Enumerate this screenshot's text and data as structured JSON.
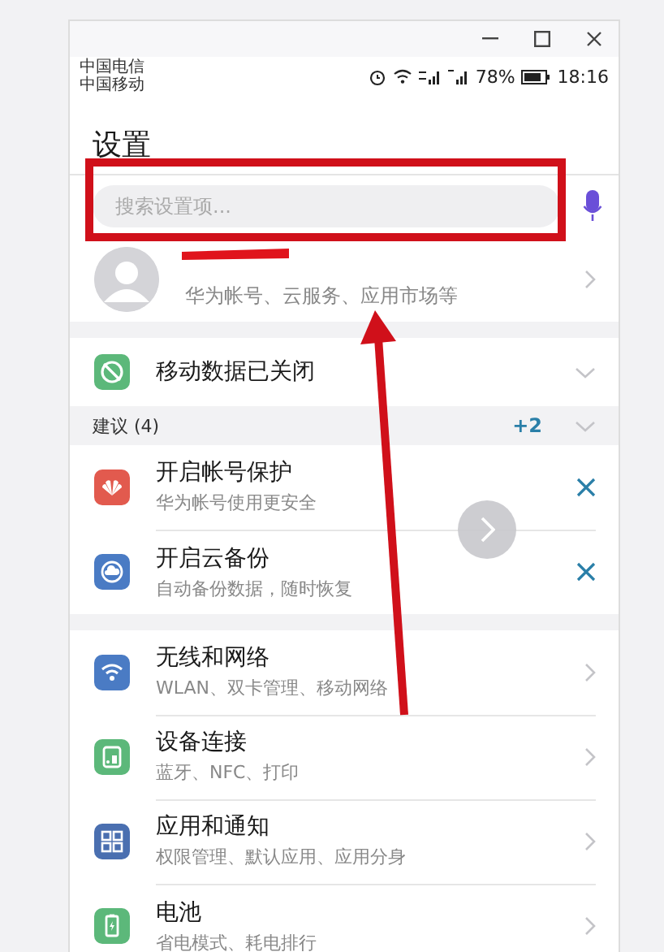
{
  "status_bar": {
    "carriers": [
      "中国电信",
      "中国移动"
    ],
    "battery": "78%",
    "time": "18:16"
  },
  "title": "设置",
  "search": {
    "placeholder": "搜索设置项..."
  },
  "account": {
    "subtitle": "华为帐号、云服务、应用市场等"
  },
  "mobile_data": {
    "label": "移动数据已关闭"
  },
  "suggestions": {
    "label": "建议 (4)",
    "more": "+2",
    "items": [
      {
        "kind": "huawei",
        "title": "开启帐号保护",
        "subtitle": "华为帐号使用更安全"
      },
      {
        "kind": "cloud",
        "title": "开启云备份",
        "subtitle": "自动备份数据，随时恢复"
      }
    ]
  },
  "settings": [
    {
      "kind": "wifi",
      "title": "无线和网络",
      "subtitle": "WLAN、双卡管理、移动网络"
    },
    {
      "kind": "device",
      "title": "设备连接",
      "subtitle": "蓝牙、NFC、打印"
    },
    {
      "kind": "apps",
      "title": "应用和通知",
      "subtitle": "权限管理、默认应用、应用分身"
    },
    {
      "kind": "battery",
      "title": "电池",
      "subtitle": "省电模式、耗电排行"
    }
  ]
}
